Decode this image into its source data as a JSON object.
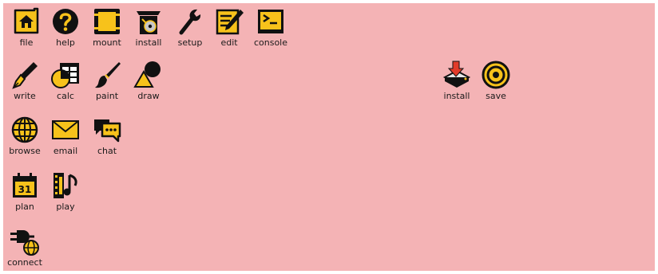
{
  "desktop": {
    "background": "#f4b3b5",
    "accent": "#f7c21b",
    "ink": "#111111",
    "icons": [
      {
        "label": "file",
        "icon": "folder-home-icon"
      },
      {
        "label": "help",
        "icon": "question-icon"
      },
      {
        "label": "mount",
        "icon": "drive-icon"
      },
      {
        "label": "install",
        "icon": "package-disc-icon"
      },
      {
        "label": "setup",
        "icon": "wrench-icon"
      },
      {
        "label": "edit",
        "icon": "notepad-pencil-icon"
      },
      {
        "label": "console",
        "icon": "terminal-icon"
      },
      {
        "label": "write",
        "icon": "fountain-pen-icon"
      },
      {
        "label": "calc",
        "icon": "spreadsheet-icon"
      },
      {
        "label": "paint",
        "icon": "paintbrush-icon"
      },
      {
        "label": "draw",
        "icon": "shapes-icon"
      },
      {
        "label": "browse",
        "icon": "globe-icon"
      },
      {
        "label": "email",
        "icon": "envelope-icon"
      },
      {
        "label": "chat",
        "icon": "speech-bubbles-icon"
      },
      {
        "label": "plan",
        "icon": "calendar-icon"
      },
      {
        "label": "play",
        "icon": "film-music-icon"
      },
      {
        "label": "connect",
        "icon": "plug-globe-icon"
      },
      {
        "label": "install",
        "icon": "install-arrow-drive-icon"
      },
      {
        "label": "save",
        "icon": "target-icon"
      }
    ]
  }
}
